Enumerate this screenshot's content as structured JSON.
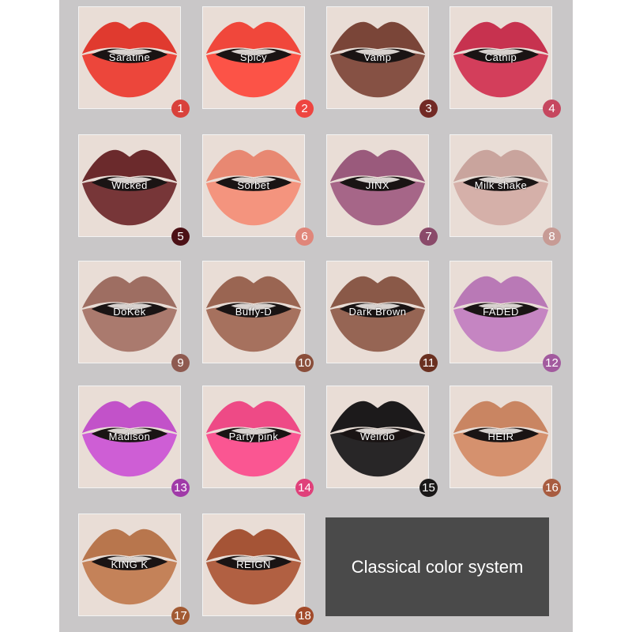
{
  "banner": {
    "text": "Classical color system"
  },
  "shades": [
    {
      "number": "1",
      "name": "Saratine",
      "color": "#e03a2f",
      "badge_color": "#d9413b"
    },
    {
      "number": "2",
      "name": "Spicy",
      "color": "#f0473b",
      "badge_color": "#ee4540"
    },
    {
      "number": "3",
      "name": "Vamp",
      "color": "#7a4538",
      "badge_color": "#722a25"
    },
    {
      "number": "4",
      "name": "Catnip",
      "color": "#c7324f",
      "badge_color": "#c6475f"
    },
    {
      "number": "5",
      "name": "Wicked",
      "color": "#6b2a2c",
      "badge_color": "#4c1116"
    },
    {
      "number": "6",
      "name": "Sorbet",
      "color": "#e88872",
      "badge_color": "#e0867a"
    },
    {
      "number": "7",
      "name": "JINX",
      "color": "#9a5a7c",
      "badge_color": "#8a4a6a"
    },
    {
      "number": "8",
      "name": "Milk shake",
      "color": "#c9a49d",
      "badge_color": "#c79b95"
    },
    {
      "number": "9",
      "name": "DoKek",
      "color": "#9e6e62",
      "badge_color": "#8e5a50"
    },
    {
      "number": "10",
      "name": "Buffy-D",
      "color": "#9a6552",
      "badge_color": "#8a4e3a"
    },
    {
      "number": "11",
      "name": "Dark Brown",
      "color": "#8a5948",
      "badge_color": "#6a3020"
    },
    {
      "number": "12",
      "name": "FADED",
      "color": "#b979b6",
      "badge_color": "#a25a9e"
    },
    {
      "number": "13",
      "name": "Madison",
      "color": "#c252c9",
      "badge_color": "#a03aa8"
    },
    {
      "number": "14",
      "name": "Party pink",
      "color": "#ee4a86",
      "badge_color": "#e0407a"
    },
    {
      "number": "15",
      "name": "Weirdo",
      "color": "#1c1a1b",
      "badge_color": "#1a1818"
    },
    {
      "number": "16",
      "name": "HEIR",
      "color": "#c98562",
      "badge_color": "#a85c40"
    },
    {
      "number": "17",
      "name": "KING K",
      "color": "#b8764d",
      "badge_color": "#a25a33"
    },
    {
      "number": "18",
      "name": "REIGN",
      "color": "#a55436",
      "badge_color": "#a24a2a"
    }
  ]
}
